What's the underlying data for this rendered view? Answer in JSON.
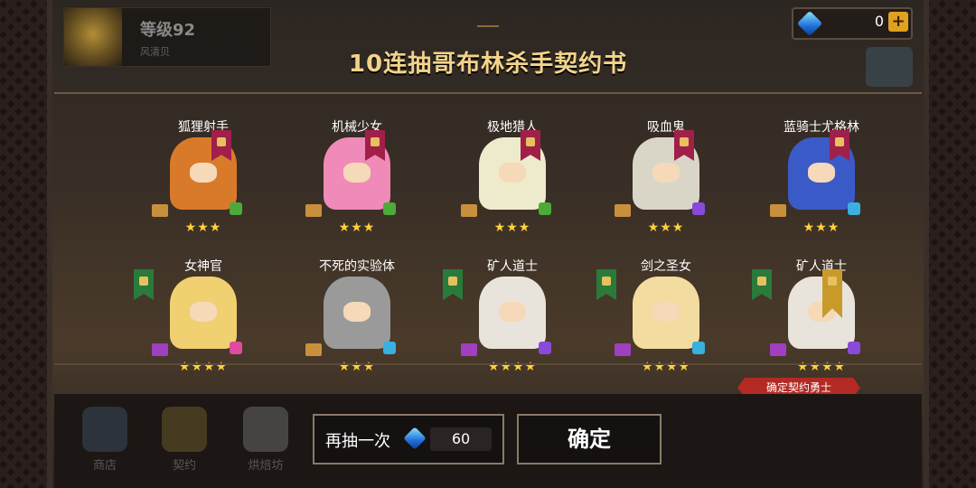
{
  "profile": {
    "level": "等级92",
    "name": "风清贝"
  },
  "currency": {
    "gems": "0",
    "plus": "+"
  },
  "title": "10连抽哥布林杀手契约书",
  "characters": [
    {
      "name": "狐狸射手",
      "stars": "★★★",
      "sprite_color": "#d97a2a",
      "class_color": "#4caa3a",
      "scroll": "gold",
      "banner": "red"
    },
    {
      "name": "机械少女",
      "stars": "★★★",
      "sprite_color": "#f08ab8",
      "class_color": "#4caa3a",
      "scroll": "gold",
      "banner": "red"
    },
    {
      "name": "极地猎人",
      "stars": "★★★",
      "sprite_color": "#eeeacc",
      "class_color": "#4caa3a",
      "scroll": "gold",
      "banner": "red"
    },
    {
      "name": "吸血鬼",
      "stars": "★★★",
      "sprite_color": "#d9d6c8",
      "class_color": "#8a4ad9",
      "scroll": "gold",
      "banner": "red"
    },
    {
      "name": "蓝骑士尤格林",
      "stars": "★★★",
      "sprite_color": "#3a5ac8",
      "class_color": "#3ab0e0",
      "scroll": "gold",
      "banner": "red"
    },
    {
      "name": "女神官",
      "stars": "★★★★",
      "sprite_color": "#f0d070",
      "class_color": "#e04aa0",
      "scroll": "purple",
      "banner": "green"
    },
    {
      "name": "不死的实验体",
      "stars": "★★★",
      "sprite_color": "#9a9a9a",
      "class_color": "#3ab0e0",
      "scroll": "gold",
      "banner": "none"
    },
    {
      "name": "矿人道士",
      "stars": "★★★★",
      "sprite_color": "#e8e4dc",
      "class_color": "#8a4ad9",
      "scroll": "purple",
      "banner": "green"
    },
    {
      "name": "剑之圣女",
      "stars": "★★★★",
      "sprite_color": "#f2dca0",
      "class_color": "#3ab0e0",
      "scroll": "purple",
      "banner": "green"
    },
    {
      "name": "矿人道士",
      "stars": "★★★★",
      "sprite_color": "#e8e4dc",
      "class_color": "#8a4ad9",
      "scroll": "purple",
      "banner": "green-gold"
    }
  ],
  "confirm_tag": "确定契约勇士",
  "nav": [
    "商店",
    "契约",
    "烘焙坊"
  ],
  "buttons": {
    "again_label": "再抽一次",
    "again_cost": "60",
    "confirm": "确定"
  }
}
